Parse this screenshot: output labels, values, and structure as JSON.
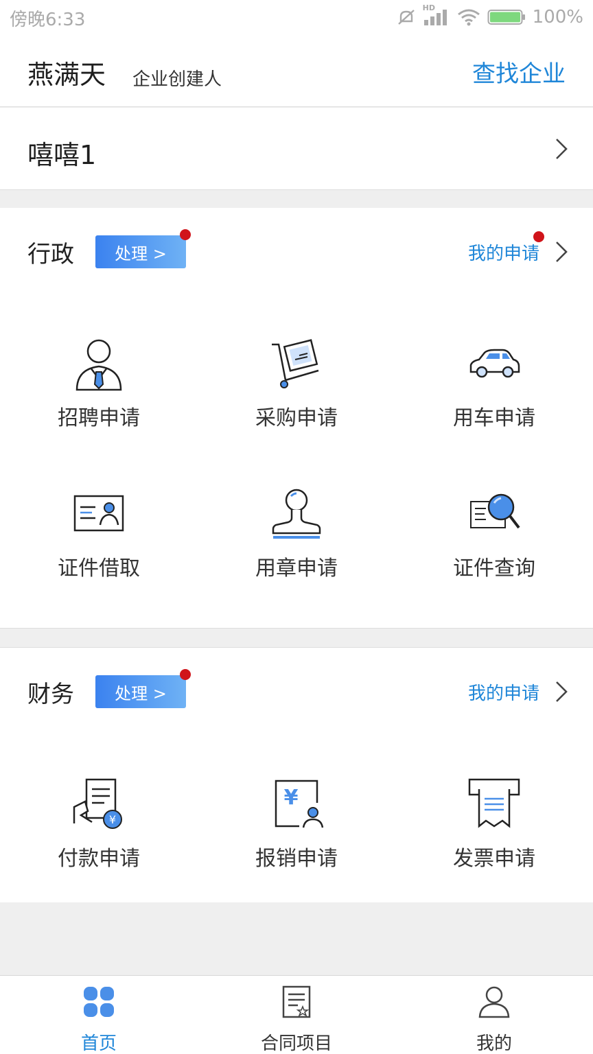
{
  "status_bar": {
    "time": "傍晚6:33",
    "battery": "100%",
    "hd_badge": "HD"
  },
  "header": {
    "user_name": "燕满天",
    "user_role": "企业创建人",
    "find_company": "查找企业"
  },
  "company": {
    "name": "嘻嘻1"
  },
  "sections": [
    {
      "title": "行政",
      "action": "处理 >",
      "my_applications": "我的申请",
      "items": [
        {
          "label": "招聘申请",
          "icon": "recruit-person-icon"
        },
        {
          "label": "采购申请",
          "icon": "purchase-cart-icon"
        },
        {
          "label": "用车申请",
          "icon": "car-icon"
        },
        {
          "label": "证件借取",
          "icon": "id-card-icon"
        },
        {
          "label": "用章申请",
          "icon": "stamp-icon"
        },
        {
          "label": "证件查询",
          "icon": "document-search-icon"
        }
      ]
    },
    {
      "title": "财务",
      "action": "处理 >",
      "my_applications": "我的申请",
      "items": [
        {
          "label": "付款申请",
          "icon": "payment-doc-icon"
        },
        {
          "label": "报销申请",
          "icon": "reimburse-icon"
        },
        {
          "label": "发票申请",
          "icon": "invoice-printer-icon"
        }
      ]
    }
  ],
  "tabs": [
    {
      "label": "首页",
      "icon": "home-grid-icon",
      "active": true
    },
    {
      "label": "合同项目",
      "icon": "contract-doc-icon",
      "active": false
    },
    {
      "label": "我的",
      "icon": "profile-person-icon",
      "active": false
    }
  ],
  "colors": {
    "accent": "#1f86d8",
    "badge_red": "#d0141a",
    "icon_blue": "#4a8fe8"
  }
}
